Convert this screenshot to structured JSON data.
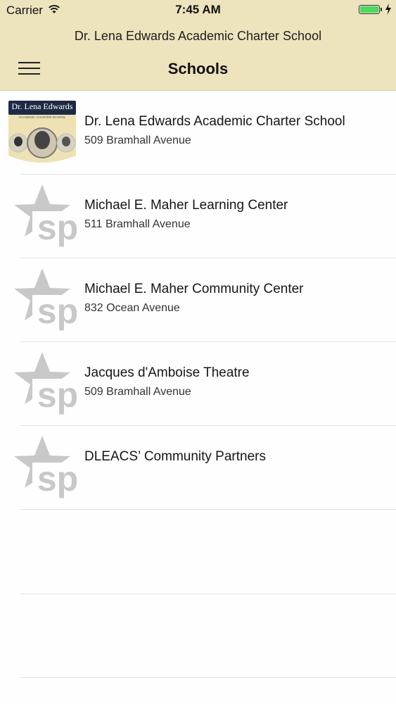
{
  "status_bar": {
    "carrier": "Carrier",
    "time": "7:45 AM",
    "battery_level": 1.0
  },
  "header": {
    "app_title": "Dr. Lena Edwards Academic Charter School",
    "nav_title": "Schools"
  },
  "schools": [
    {
      "name": "Dr. Lena Edwards Academic Charter School",
      "address": "509 Bramhall Avenue",
      "logo_text": "Dr. Lena Edwards",
      "logo_subtext": "ACADEMIC CHARTER SCHOOL"
    },
    {
      "name": "Michael E. Maher Learning Center",
      "address": "511 Bramhall Avenue",
      "logo_text": "sp"
    },
    {
      "name": "Michael E. Maher Community Center",
      "address": "832 Ocean Avenue",
      "logo_text": "sp"
    },
    {
      "name": "Jacques d'Amboise Theatre",
      "address": "509 Bramhall Avenue",
      "logo_text": "sp"
    },
    {
      "name": "DLEACS’ Community Partners",
      "address": "",
      "logo_text": "sp"
    }
  ],
  "colors": {
    "header_bg": "#ede3bd",
    "battery": "#4cd964",
    "placeholder_logo": "#c8c8c8"
  }
}
